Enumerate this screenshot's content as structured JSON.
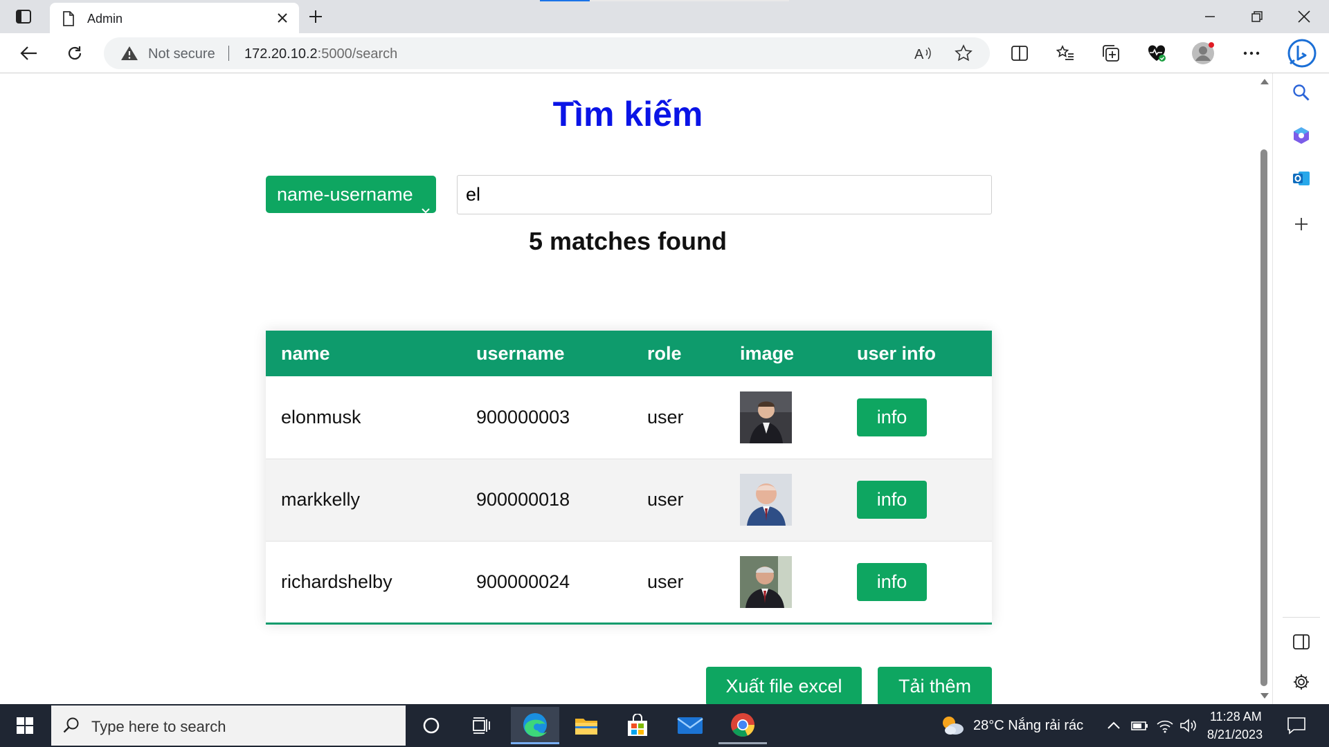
{
  "browser": {
    "tab_title": "Admin",
    "security_label": "Not secure",
    "url_host": "172.20.10.2",
    "url_path": ":5000/search"
  },
  "page": {
    "title": "Tìm kiếm",
    "filter_selected": "name-username",
    "search_value": "el",
    "match_text": "5 matches found",
    "table": {
      "headers": [
        "name",
        "username",
        "role",
        "image",
        "user info"
      ],
      "rows": [
        {
          "name": "elonmusk",
          "username": "900000003",
          "role": "user",
          "info_label": "info"
        },
        {
          "name": "markkelly",
          "username": "900000018",
          "role": "user",
          "info_label": "info"
        },
        {
          "name": "richardshelby",
          "username": "900000024",
          "role": "user",
          "info_label": "info"
        }
      ]
    },
    "export_button": "Xuất file excel",
    "load_more_button": "Tải thêm"
  },
  "taskbar": {
    "search_placeholder": "Type here to search",
    "weather": "28°C  Nắng rải rác",
    "time": "11:28 AM",
    "date": "8/21/2023"
  },
  "colors": {
    "title_blue": "#0a14e6",
    "accent_green": "#0ea661",
    "header_green": "#0e9b6c"
  },
  "icons": [
    "tab-actions-icon",
    "page-icon",
    "close-icon",
    "plus-icon",
    "minimize-icon",
    "maximize-icon",
    "back-icon",
    "refresh-icon",
    "warning-icon",
    "read-aloud-icon",
    "favorite-star-icon",
    "split-screen-icon",
    "favorites-icon",
    "collections-icon",
    "heartbeat-icon",
    "profile-icon",
    "more-icon",
    "bing-icon",
    "search-icon",
    "copilot-icon",
    "outlook-icon",
    "settings-icon",
    "windows-icon",
    "cortana-icon",
    "task-view-icon",
    "edge-icon",
    "file-explorer-icon",
    "store-icon",
    "mail-icon",
    "chrome-icon",
    "weather-icon",
    "chevron-up-icon",
    "battery-icon",
    "wifi-icon",
    "volume-icon",
    "notification-icon"
  ]
}
